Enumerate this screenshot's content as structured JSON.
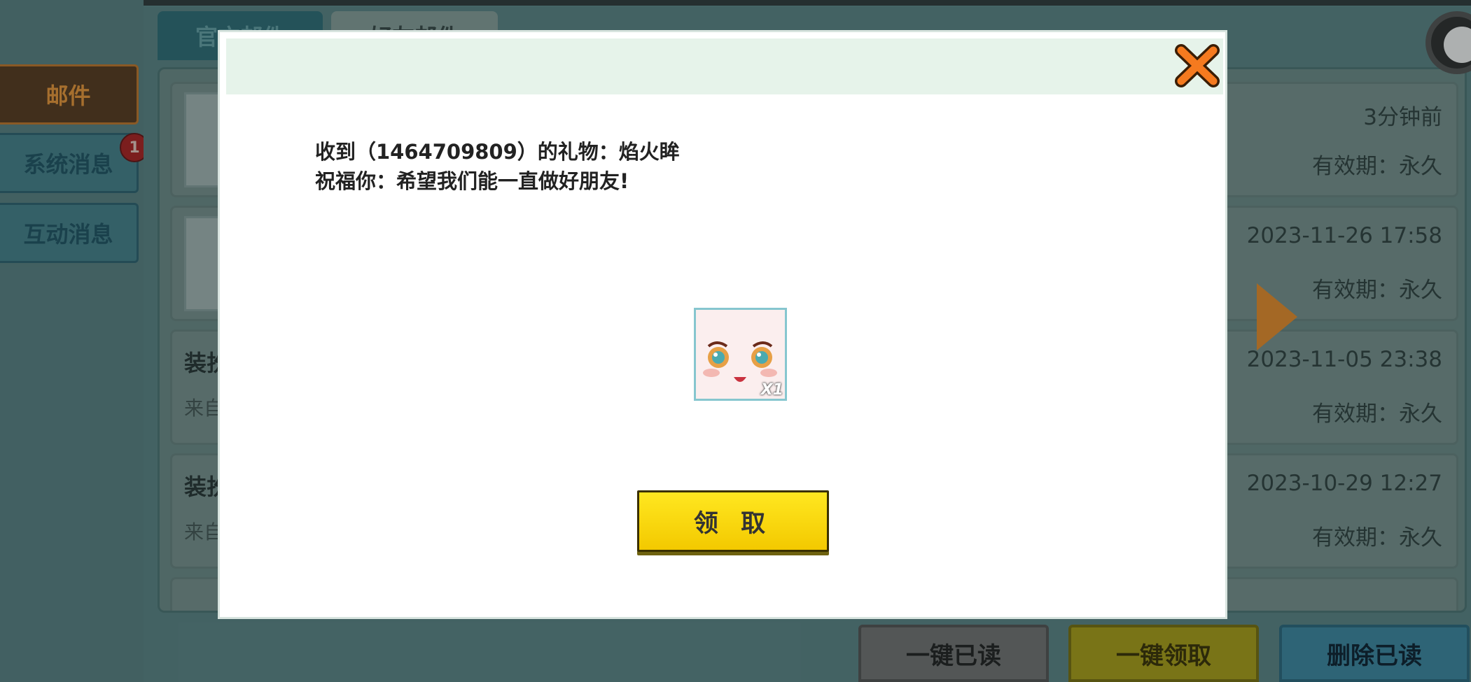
{
  "sidebar": {
    "items": [
      {
        "label": "邮件"
      },
      {
        "label": "系统消息"
      },
      {
        "label": "互动消息"
      }
    ],
    "badge": "1"
  },
  "tabs": [
    {
      "label": "官方邮件"
    },
    {
      "label": "好友邮件"
    }
  ],
  "mail_list": [
    {
      "title": "",
      "sub": "",
      "time": "3分钟前",
      "expiry": "有效期：永久"
    },
    {
      "title": "",
      "sub": "",
      "time": "2023-11-26 17:58",
      "expiry": "有效期：永久"
    },
    {
      "title": "装扮",
      "sub": "来自",
      "time": "2023-11-05 23:38",
      "expiry": "有效期：永久"
    },
    {
      "title": "装扮",
      "sub": "来自",
      "time": "2023-10-29 12:27",
      "expiry": "有效期：永久"
    }
  ],
  "bottom_buttons": {
    "read_all": "一键已读",
    "claim_all": "一键领取",
    "delete_read": "删除已读"
  },
  "dialog": {
    "line1": "收到（1464709809）的礼物：焰火眸",
    "line2": "祝福你：希望我们能一直做好朋友!",
    "gift_count": "X1",
    "claim_label": "领 取"
  },
  "colors": {
    "accent_orange": "#f2912a",
    "claim_yellow": "#ffe720",
    "badge_red": "#b32020"
  }
}
